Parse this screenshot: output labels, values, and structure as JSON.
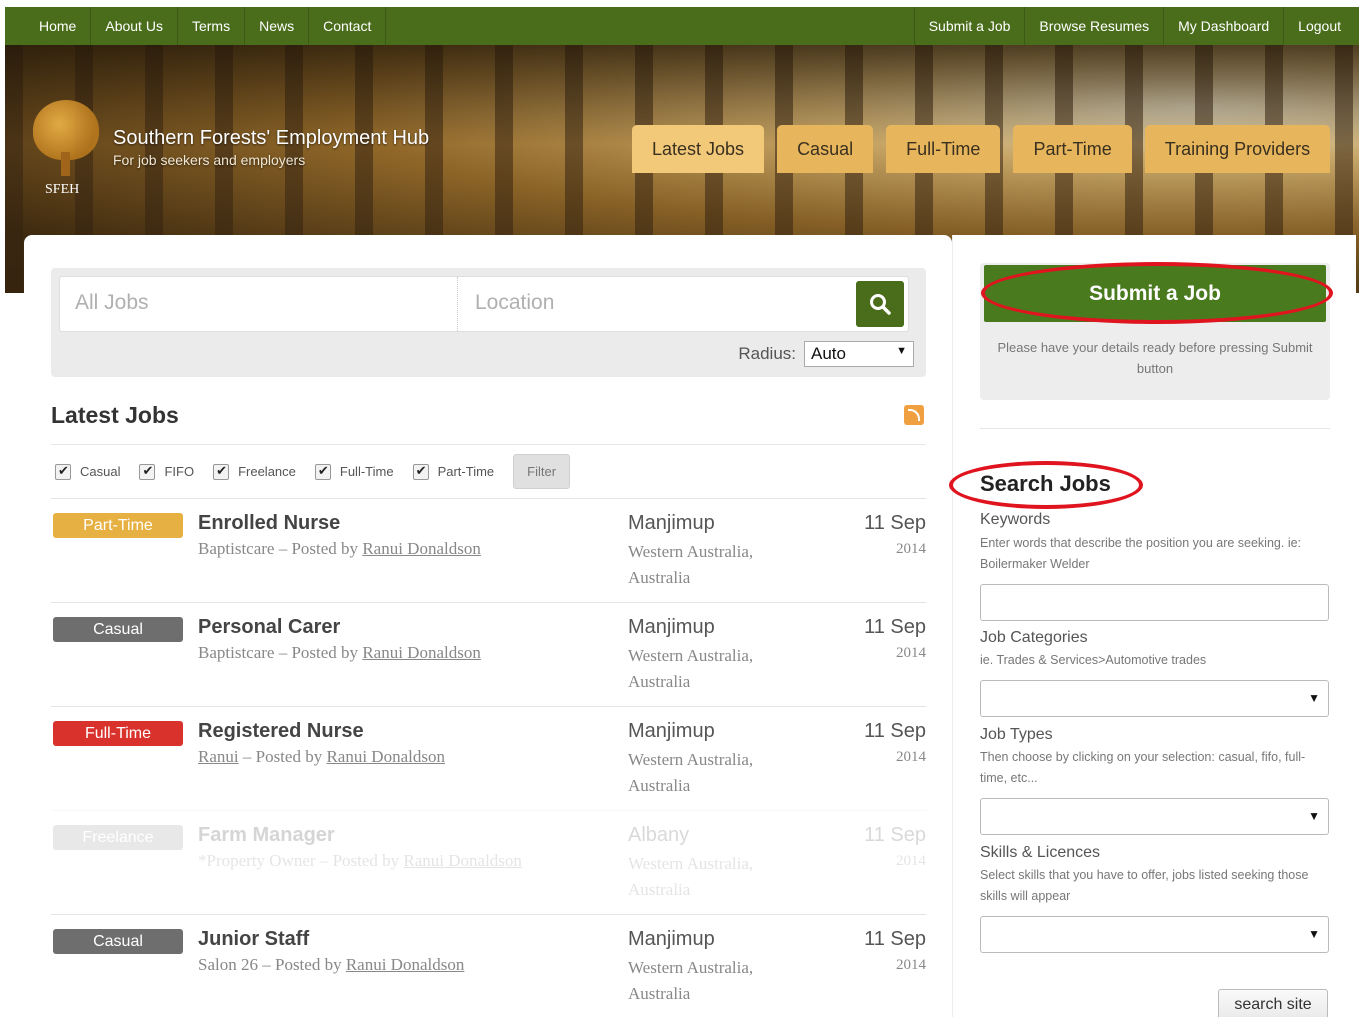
{
  "topnav": {
    "left": [
      "Home",
      "About Us",
      "Terms",
      "News",
      "Contact"
    ],
    "right": [
      "Submit a Job",
      "Browse Resumes",
      "My Dashboard",
      "Logout"
    ]
  },
  "header": {
    "logo_abbr": "SFEH",
    "site_title": "Southern Forests' Employment Hub",
    "tagline": "For job seekers and employers",
    "tabs": [
      "Latest Jobs",
      "Casual",
      "Full-Time",
      "Part-Time",
      "Training Providers"
    ],
    "active_tab": "Latest Jobs"
  },
  "search": {
    "keywords_placeholder": "All Jobs",
    "location_placeholder": "Location",
    "radius_label": "Radius:",
    "radius_value": "Auto"
  },
  "latest": {
    "heading": "Latest Jobs",
    "filters": [
      "Casual",
      "FIFO",
      "Freelance",
      "Full-Time",
      "Part-Time"
    ],
    "filter_button": "Filter"
  },
  "jobs": [
    {
      "type": "Part-Time",
      "color": "#e7b042",
      "title": "Enrolled Nurse",
      "company": "Baptistcare",
      "posted_prefix": " – Posted by ",
      "poster": "Ranui Donaldson",
      "city": "Manjimup",
      "region": "Western Australia, Australia",
      "date": "11 Sep",
      "year": "2014",
      "company_link": false,
      "faded": false
    },
    {
      "type": "Casual",
      "color": "#6e6e6e",
      "title": "Personal Carer",
      "company": "Baptistcare",
      "posted_prefix": " – Posted by ",
      "poster": "Ranui Donaldson",
      "city": "Manjimup",
      "region": "Western Australia, Australia",
      "date": "11 Sep",
      "year": "2014",
      "company_link": false,
      "faded": false
    },
    {
      "type": "Full-Time",
      "color": "#d9322c",
      "title": "Registered Nurse",
      "company": "Ranui",
      "posted_prefix": " – Posted by ",
      "poster": "Ranui Donaldson",
      "city": "Manjimup",
      "region": "Western Australia, Australia",
      "date": "11 Sep",
      "year": "2014",
      "company_link": true,
      "faded": false
    },
    {
      "type": "Freelance",
      "color": "#9a9a9a",
      "title": "Farm Manager",
      "company": "*Property Owner",
      "posted_prefix": " – Posted by ",
      "poster": "Ranui Donaldson",
      "city": "Albany",
      "region": "Western Australia, Australia",
      "date": "11 Sep",
      "year": "2014",
      "company_link": false,
      "faded": true
    },
    {
      "type": "Casual",
      "color": "#6e6e6e",
      "title": "Junior Staff",
      "company": "Salon 26",
      "posted_prefix": " – Posted by ",
      "poster": "Ranui Donaldson",
      "city": "Manjimup",
      "region": "Western Australia, Australia",
      "date": "11 Sep",
      "year": "2014",
      "company_link": false,
      "faded": false
    }
  ],
  "sidebar": {
    "submit_button": "Submit a Job",
    "submit_note": "Please have your details ready before pressing Submit button",
    "search_title": "Search Jobs",
    "keywords_label": "Keywords",
    "keywords_help": "Enter words that describe the position you are seeking. ie: Boilermaker Welder",
    "categories_label": "Job Categories",
    "categories_help": "ie. Trades & Services>Automotive trades",
    "types_label": "Job Types",
    "types_help": "Then choose by clicking on your selection: casual, fifo, full-time, etc...",
    "skills_label": "Skills & Licences",
    "skills_help": "Select skills that you have to offer, jobs listed seeking those skills will appear",
    "search_button": "search site",
    "highlight_color": "#e0141e"
  }
}
